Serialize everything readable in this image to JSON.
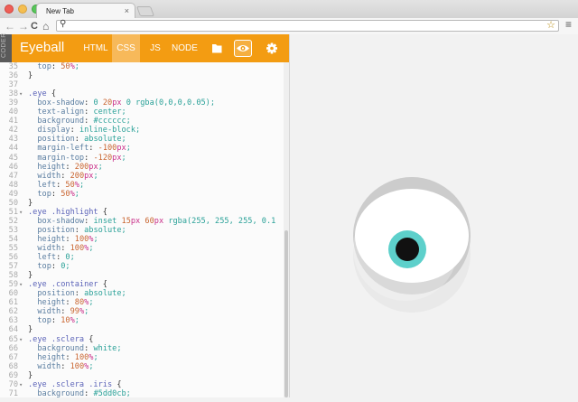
{
  "browser": {
    "tab_title": "New Tab",
    "tab_close": "×",
    "url_value": "",
    "nav_back": "←",
    "nav_forward": "→",
    "nav_reload": "C",
    "nav_home": "⌂",
    "star": "☆",
    "menu": "≡",
    "search_glyph": "⚲"
  },
  "editor": {
    "badge": "CODER",
    "app_title": "Eyeball",
    "tabs": [
      {
        "label": "HTML",
        "active": false
      },
      {
        "label": "CSS",
        "active": true
      },
      {
        "label": "JS",
        "active": false
      },
      {
        "label": "NODE",
        "active": false
      }
    ],
    "icons": [
      "folder-icon",
      "eye-icon",
      "gear-icon"
    ]
  },
  "code_lines": [
    {
      "n": "35",
      "fold": "",
      "text": "  top: 50%;"
    },
    {
      "n": "36",
      "fold": "",
      "text": "}"
    },
    {
      "n": "37",
      "fold": "",
      "text": ""
    },
    {
      "n": "38",
      "fold": "▾",
      "text": ".eye {"
    },
    {
      "n": "39",
      "fold": "",
      "text": "  box-shadow: 0 20px 0 rgba(0,0,0,0.05);"
    },
    {
      "n": "40",
      "fold": "",
      "text": "  text-align: center;"
    },
    {
      "n": "41",
      "fold": "",
      "text": "  background: #cccccc;"
    },
    {
      "n": "42",
      "fold": "",
      "text": "  display: inline-block;"
    },
    {
      "n": "43",
      "fold": "",
      "text": "  position: absolute;"
    },
    {
      "n": "44",
      "fold": "",
      "text": "  margin-left: -100px;"
    },
    {
      "n": "45",
      "fold": "",
      "text": "  margin-top: -120px;"
    },
    {
      "n": "46",
      "fold": "",
      "text": "  height: 200px;"
    },
    {
      "n": "47",
      "fold": "",
      "text": "  width: 200px;"
    },
    {
      "n": "48",
      "fold": "",
      "text": "  left: 50%;"
    },
    {
      "n": "49",
      "fold": "",
      "text": "  top: 50%;"
    },
    {
      "n": "50",
      "fold": "",
      "text": "}"
    },
    {
      "n": "51",
      "fold": "▾",
      "text": ".eye .highlight {"
    },
    {
      "n": "52",
      "fold": "",
      "text": "  box-shadow: inset 15px 60px rgba(255, 255, 255, 0.1"
    },
    {
      "n": "53",
      "fold": "",
      "text": "  position: absolute;"
    },
    {
      "n": "54",
      "fold": "",
      "text": "  height: 100%;"
    },
    {
      "n": "55",
      "fold": "",
      "text": "  width: 100%;"
    },
    {
      "n": "56",
      "fold": "",
      "text": "  left: 0;"
    },
    {
      "n": "57",
      "fold": "",
      "text": "  top: 0;"
    },
    {
      "n": "58",
      "fold": "",
      "text": "}"
    },
    {
      "n": "59",
      "fold": "▾",
      "text": ".eye .container {"
    },
    {
      "n": "60",
      "fold": "",
      "text": "  position: absolute;"
    },
    {
      "n": "61",
      "fold": "",
      "text": "  height: 80%;"
    },
    {
      "n": "62",
      "fold": "",
      "text": "  width: 99%;"
    },
    {
      "n": "63",
      "fold": "",
      "text": "  top: 10%;"
    },
    {
      "n": "64",
      "fold": "",
      "text": "}"
    },
    {
      "n": "65",
      "fold": "▾",
      "text": ".eye .sclera {"
    },
    {
      "n": "66",
      "fold": "",
      "text": "  background: white;"
    },
    {
      "n": "67",
      "fold": "",
      "text": "  height: 100%;"
    },
    {
      "n": "68",
      "fold": "",
      "text": "  width: 100%;"
    },
    {
      "n": "69",
      "fold": "",
      "text": "}"
    },
    {
      "n": "70",
      "fold": "▾",
      "text": ".eye .sclera .iris {"
    },
    {
      "n": "71",
      "fold": "",
      "text": "  background: #5dd0cb;"
    }
  ],
  "colors": {
    "header": "#f39c12",
    "active_tab": "#f7b95a",
    "iris": "#5dd0cb",
    "eye_ring": "#cccccc"
  }
}
